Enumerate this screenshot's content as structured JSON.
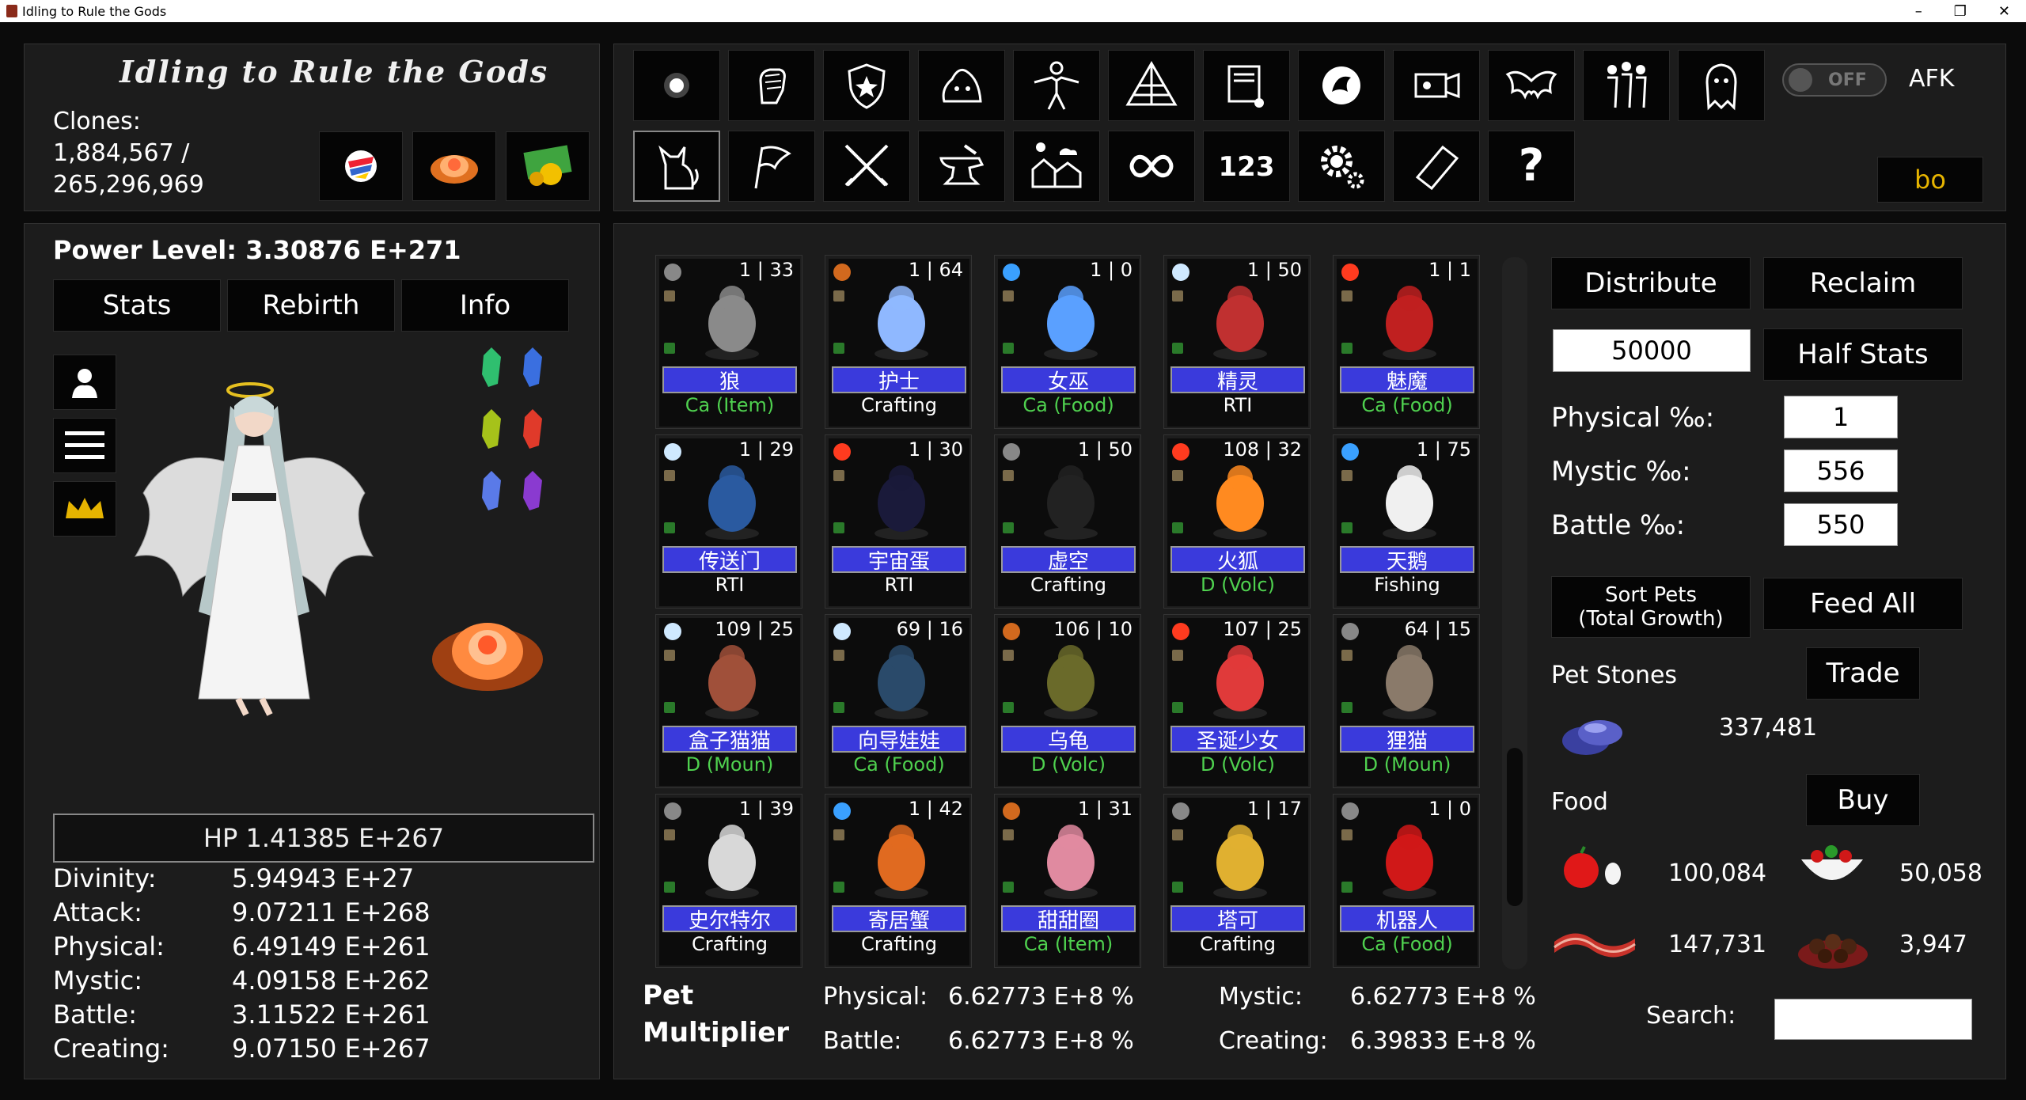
{
  "window": {
    "title": "Idling to Rule the Gods",
    "minimize": "–",
    "maximize": "❐",
    "close": "✕"
  },
  "header": {
    "logo": "Idling to Rule the Gods",
    "clones_label": "Clones:",
    "clones_value": "1,884,567 /",
    "clones_max": "265,296,969"
  },
  "toggle": {
    "state": "OFF",
    "afk_label": "AFK"
  },
  "user_box": "bo",
  "left": {
    "power_level": "Power Level: 3.30876 E+271",
    "tabs": [
      "Stats",
      "Rebirth",
      "Info"
    ],
    "hp": "HP 1.41385 E+267",
    "stats": [
      {
        "label": "Divinity:",
        "value": "5.94943 E+27"
      },
      {
        "label": "Attack:",
        "value": "9.07211 E+268"
      },
      {
        "label": "Physical:",
        "value": "6.49149 E+261"
      },
      {
        "label": "Mystic:",
        "value": "4.09158 E+262"
      },
      {
        "label": "Battle:",
        "value": "3.11522 E+261"
      },
      {
        "label": "Creating:",
        "value": "9.07150 E+267"
      }
    ]
  },
  "pets": [
    {
      "name": "狼",
      "level": "1 | 33",
      "job": "Ca (Item)",
      "job_color": "#4fd14f",
      "elem": "#888"
    },
    {
      "name": "护士",
      "level": "1 | 64",
      "job": "Crafting",
      "job_color": "#ffffff",
      "elem": "#d2691e"
    },
    {
      "name": "女巫",
      "level": "1 | 0",
      "job": "Ca (Food)",
      "job_color": "#4fd14f",
      "elem": "#3aa0ff"
    },
    {
      "name": "精灵",
      "level": "1 | 50",
      "job": "RTI",
      "job_color": "#ffffff",
      "elem": "#cfe9ff"
    },
    {
      "name": "魅魔",
      "level": "1 | 1",
      "job": "Ca (Food)",
      "job_color": "#4fd14f",
      "elem": "#ff3b1f"
    },
    {
      "name": "传送门",
      "level": "1 | 29",
      "job": "RTI",
      "job_color": "#ffffff",
      "elem": "#cfe9ff"
    },
    {
      "name": "宇宙蛋",
      "level": "1 | 30",
      "job": "RTI",
      "job_color": "#ffffff",
      "elem": "#ff3b1f"
    },
    {
      "name": "虚空",
      "level": "1 | 50",
      "job": "Crafting",
      "job_color": "#ffffff",
      "elem": "#888"
    },
    {
      "name": "火狐",
      "level": "108 | 32",
      "job": "D (Volc)",
      "job_color": "#4fd14f",
      "elem": "#ff3b1f"
    },
    {
      "name": "天鹅",
      "level": "1 | 75",
      "job": "Fishing",
      "job_color": "#ffffff",
      "elem": "#3aa0ff"
    },
    {
      "name": "盒子猫猫",
      "level": "109 | 25",
      "job": "D (Moun)",
      "job_color": "#4fd14f",
      "elem": "#cfe9ff"
    },
    {
      "name": "向导娃娃",
      "level": "69 | 16",
      "job": "Ca (Food)",
      "job_color": "#4fd14f",
      "elem": "#cfe9ff"
    },
    {
      "name": "乌龟",
      "level": "106 | 10",
      "job": "D (Volc)",
      "job_color": "#4fd14f",
      "elem": "#d2691e"
    },
    {
      "name": "圣诞少女",
      "level": "107 | 25",
      "job": "D (Volc)",
      "job_color": "#4fd14f",
      "elem": "#ff3b1f"
    },
    {
      "name": "狸猫",
      "level": "64 | 15",
      "job": "D (Moun)",
      "job_color": "#4fd14f",
      "elem": "#888"
    },
    {
      "name": "史尔特尔",
      "level": "1 | 39",
      "job": "Crafting",
      "job_color": "#ffffff",
      "elem": "#888"
    },
    {
      "name": "寄居蟹",
      "level": "1 | 42",
      "job": "Crafting",
      "job_color": "#ffffff",
      "elem": "#3aa0ff"
    },
    {
      "name": "甜甜圈",
      "level": "1 | 31",
      "job": "Ca (Item)",
      "job_color": "#4fd14f",
      "elem": "#d2691e"
    },
    {
      "name": "塔可",
      "level": "1 | 17",
      "job": "Crafting",
      "job_color": "#ffffff",
      "elem": "#888"
    },
    {
      "name": "机器人",
      "level": "1 | 0",
      "job": "Ca (Food)",
      "job_color": "#4fd14f",
      "elem": "#888"
    }
  ],
  "multiplier": {
    "title_line1": "Pet",
    "title_line2": "Multiplier",
    "physical_label": "Physical:",
    "physical_value": "6.62773 E+8 %",
    "mystic_label": "Mystic:",
    "mystic_value": "6.62773 E+8 %",
    "battle_label": "Battle:",
    "battle_value": "6.62773 E+8 %",
    "creating_label": "Creating:",
    "creating_value": "6.39833 E+8 %"
  },
  "right": {
    "distribute": "Distribute",
    "reclaim": "Reclaim",
    "amount": "50000",
    "half_stats": "Half Stats",
    "physical_label": "Physical ‰:",
    "physical_value": "1",
    "mystic_label": "Mystic ‰:",
    "mystic_value": "556",
    "battle_label": "Battle ‰:",
    "battle_value": "550",
    "sort_line1": "Sort Pets",
    "sort_line2": "(Total Growth)",
    "feed_all": "Feed All",
    "pet_stones_label": "Pet Stones",
    "trade": "Trade",
    "pet_stones_value": "337,481",
    "food_label": "Food",
    "buy": "Buy",
    "food1": "100,084",
    "food2": "50,058",
    "food3": "147,731",
    "food4": "3,947",
    "search_label": "Search:",
    "search_value": ""
  },
  "colors": {
    "accent_gold": "#e6b400",
    "pet_name_bg": "#3a3adc",
    "job_green": "#4fd14f"
  }
}
